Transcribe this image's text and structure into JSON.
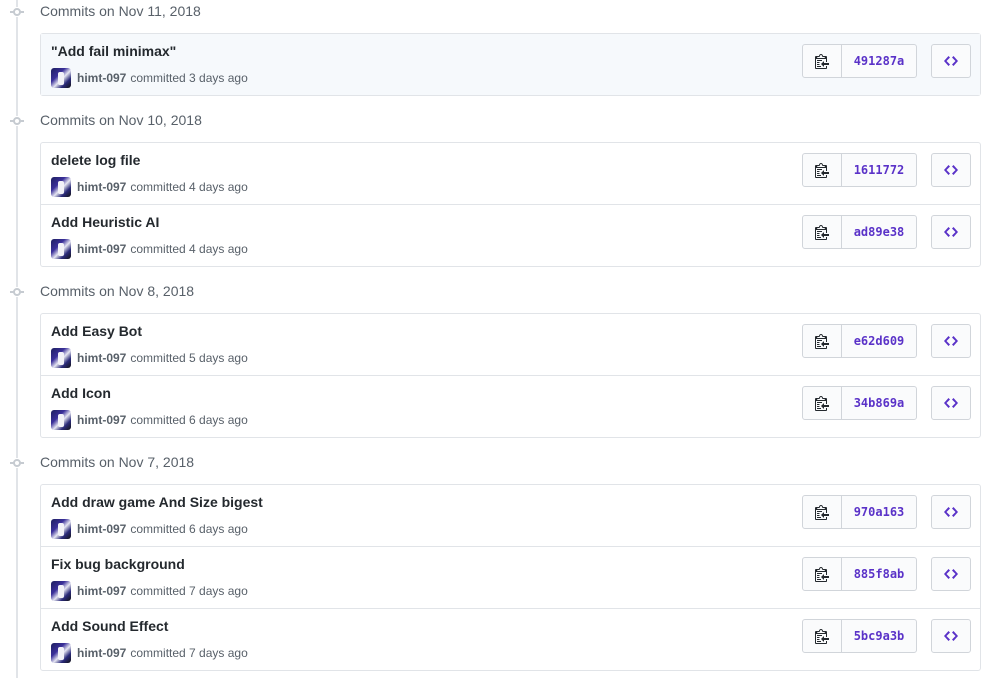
{
  "groups": [
    {
      "title": "Commits on Nov 11, 2018",
      "commits": [
        {
          "message": "\"Add fail minimax\"",
          "author": "himt-097",
          "time": "committed 3 days ago",
          "sha": "491287a"
        }
      ]
    },
    {
      "title": "Commits on Nov 10, 2018",
      "commits": [
        {
          "message": "delete log file",
          "author": "himt-097",
          "time": "committed 4 days ago",
          "sha": "1611772"
        },
        {
          "message": "Add Heuristic AI",
          "author": "himt-097",
          "time": "committed 4 days ago",
          "sha": "ad89e38"
        }
      ]
    },
    {
      "title": "Commits on Nov 8, 2018",
      "commits": [
        {
          "message": "Add Easy Bot",
          "author": "himt-097",
          "time": "committed 5 days ago",
          "sha": "e62d609"
        },
        {
          "message": "Add Icon",
          "author": "himt-097",
          "time": "committed 6 days ago",
          "sha": "34b869a"
        }
      ]
    },
    {
      "title": "Commits on Nov 7, 2018",
      "commits": [
        {
          "message": "Add draw game And Size bigest",
          "author": "himt-097",
          "time": "committed 6 days ago",
          "sha": "970a163"
        },
        {
          "message": "Fix bug background",
          "author": "himt-097",
          "time": "committed 7 days ago",
          "sha": "885f8ab"
        },
        {
          "message": "Add Sound Effect",
          "author": "himt-097",
          "time": "committed 7 days ago",
          "sha": "5bc9a3b"
        }
      ]
    }
  ],
  "icons": {
    "copy": "clipboard-icon",
    "browse": "code-icon",
    "timeline": "git-commit-icon"
  },
  "colors": {
    "sha": "#5a32c8",
    "highlight_row": "#f6f9fc",
    "border": "#e1e4e8",
    "muted_text": "#586069"
  }
}
